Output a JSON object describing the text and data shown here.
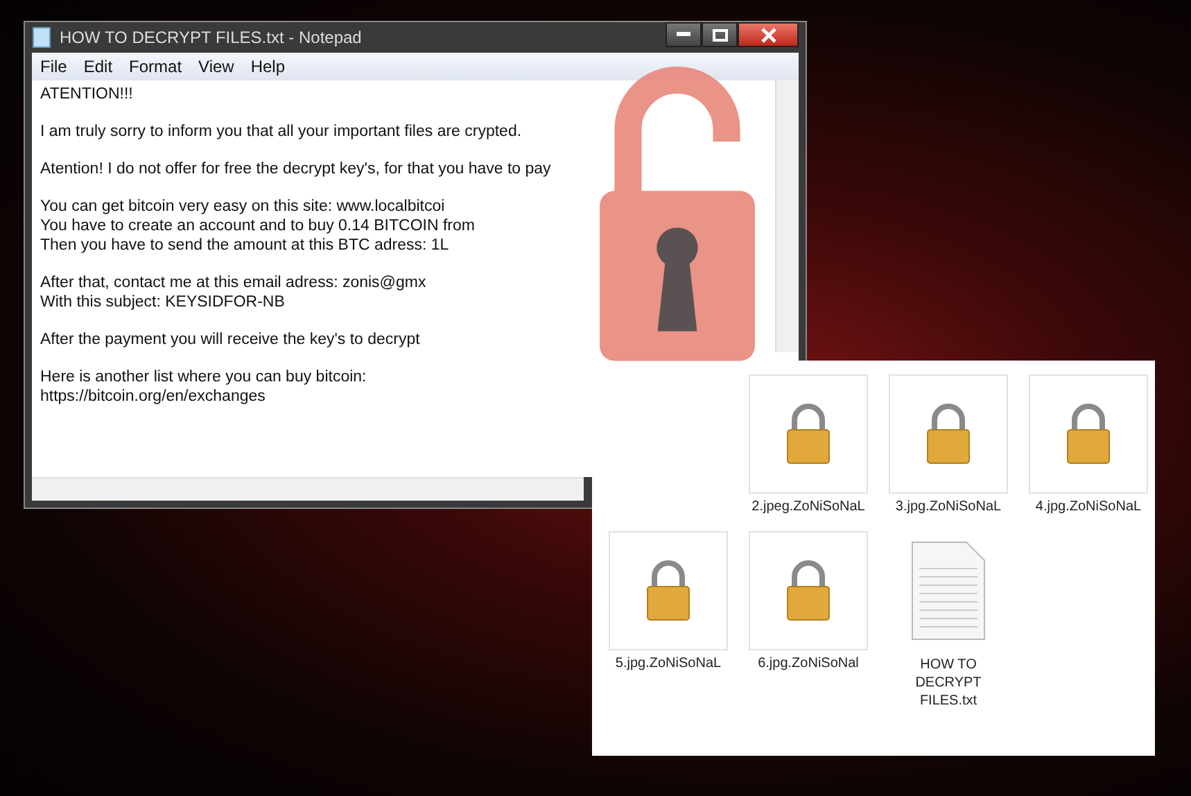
{
  "notepad": {
    "title": "HOW TO DECRYPT FILES.txt - Notepad",
    "menu": [
      "File",
      "Edit",
      "Format",
      "View",
      "Help"
    ],
    "paragraphs": [
      [
        "ATENTION!!!"
      ],
      [
        "I am truly sorry to inform you that all your important files are crypted."
      ],
      [
        "Atention! I do not offer for free the decrypt key's, for that you have to pay"
      ],
      [
        "You can get bitcoin very easy on this site: www.localbitcoi",
        "You have to create an account and to buy 0.14 BITCOIN from",
        "Then you have to send the amount at this BTC adress: 1L"
      ],
      [
        "After that, contact me at this email adress: zonis@gmx",
        "With this subject: KEYSIDFOR-NB"
      ],
      [
        "After the payment you will receive the key's to decrypt"
      ],
      [
        "Here is another list where you can buy bitcoin:",
        "https://bitcoin.org/en/exchanges"
      ]
    ]
  },
  "files": [
    {
      "kind": "locked",
      "name": "2.jpeg.ZoNiSoNaL"
    },
    {
      "kind": "locked",
      "name": "3.jpg.ZoNiSoNaL"
    },
    {
      "kind": "locked",
      "name": "4.jpg.ZoNiSoNaL"
    },
    {
      "kind": "locked",
      "name": "5.jpg.ZoNiSoNaL"
    },
    {
      "kind": "locked",
      "name": "6.jpg.ZoNiSoNal"
    },
    {
      "kind": "text",
      "name": "HOW TO DECRYPT FILES.txt"
    }
  ]
}
